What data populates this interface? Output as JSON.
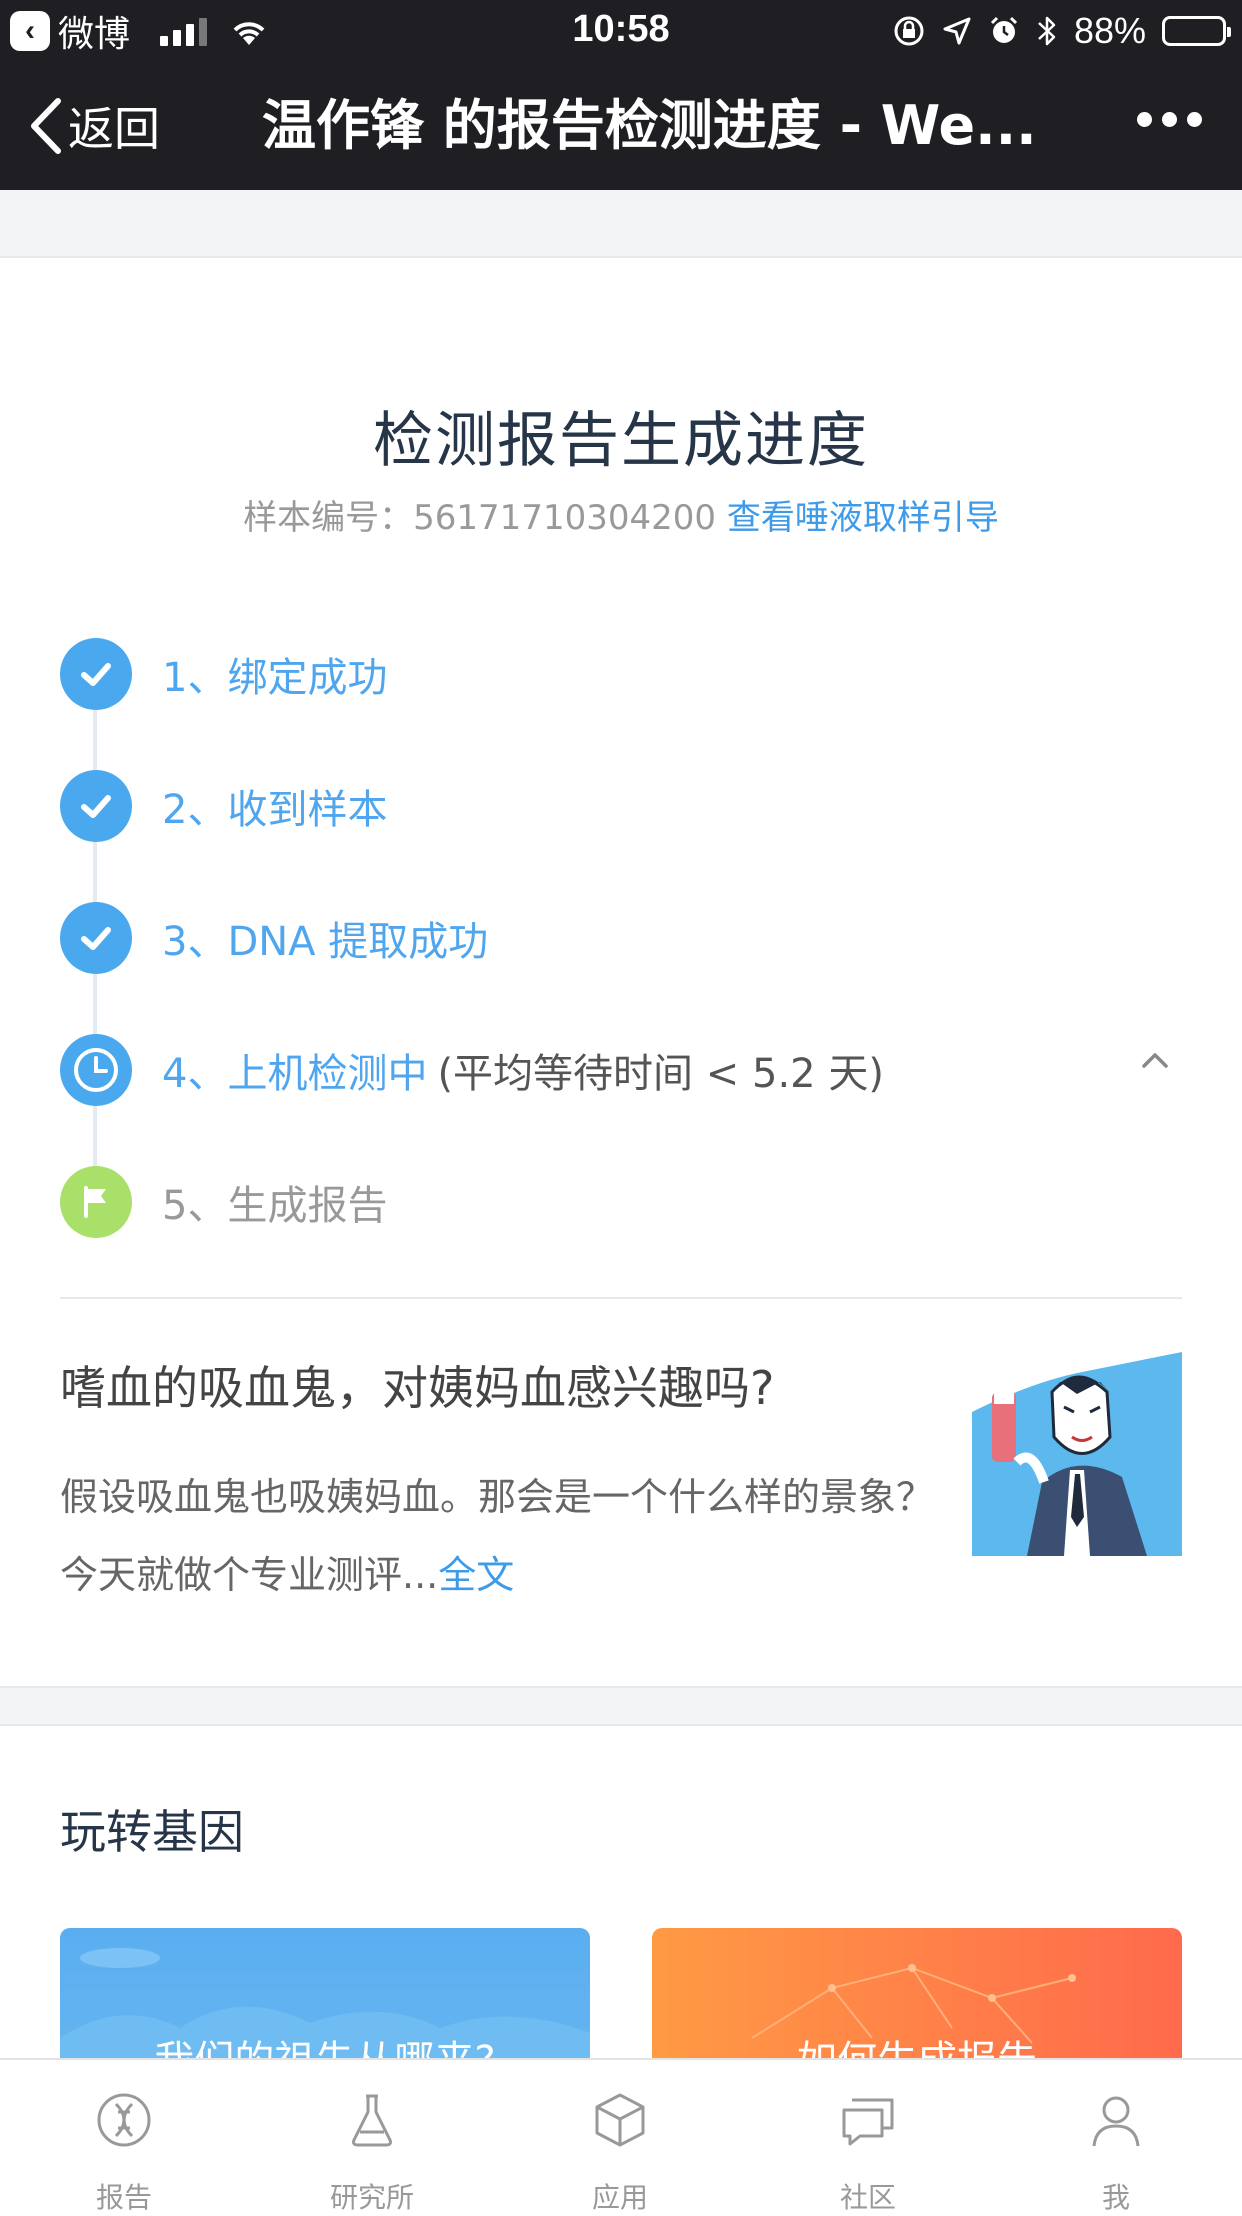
{
  "status_bar": {
    "app_name": "微博",
    "time": "10:58",
    "battery": "88%",
    "battery_level": 0.88
  },
  "nav": {
    "back_label": "返回",
    "title": "温作锋 的报告检测进度 - We..."
  },
  "progress": {
    "title": "检测报告生成进度",
    "sample_label": "样本编号：",
    "sample_id": "56171710304200",
    "guide_link": "查看唾液取样引导",
    "steps": [
      {
        "label": "1、绑定成功",
        "status": "done"
      },
      {
        "label": "2、收到样本",
        "status": "done"
      },
      {
        "label": "3、DNA 提取成功",
        "status": "done"
      },
      {
        "label": "4、上机检测中",
        "extra": "(平均等待时间 < 5.2 天)",
        "status": "in-progress"
      },
      {
        "label": "5、生成报告",
        "status": "pending"
      }
    ]
  },
  "article": {
    "title": "嗜血的吸血鬼，对姨妈血感兴趣吗?",
    "body": "假设吸血鬼也吸姨妈血。那会是一个什么样的景象？今天就做个专业测评...",
    "more_link": "全文"
  },
  "section": {
    "title": "玩转基因",
    "tiles": [
      {
        "label": "我们的祖先从哪来?",
        "color": "#5aaef0"
      },
      {
        "label": "如何生成报告",
        "color": "#ff7a48"
      }
    ]
  },
  "tabbar": {
    "tabs": [
      {
        "label": "报告",
        "icon": "dna-icon"
      },
      {
        "label": "研究所",
        "icon": "flask-icon"
      },
      {
        "label": "应用",
        "icon": "cube-icon"
      },
      {
        "label": "社区",
        "icon": "chat-icon"
      },
      {
        "label": "我",
        "icon": "user-icon"
      }
    ]
  },
  "colors": {
    "accent": "#3d9be9",
    "step_done": "#4aa8ee",
    "step_pending": "#a8e06a",
    "nav_bg": "#1f1f23"
  }
}
